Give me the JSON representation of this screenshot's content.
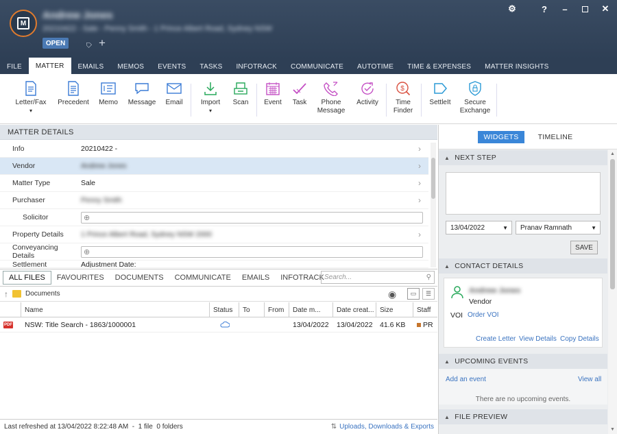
{
  "header": {
    "client_name": "Andrew Jones",
    "matter_line": "20210422 - Sale - Penny Smith - 1 Prince Albert Road, Sydney NSW",
    "status_badge": "OPEN",
    "window_controls": [
      "gear-icon",
      "help-icon",
      "minimize-icon",
      "maximize-icon",
      "close-icon"
    ],
    "help_label": "?"
  },
  "tabs": [
    "FILE",
    "MATTER",
    "EMAILS",
    "MEMOS",
    "EVENTS",
    "TASKS",
    "INFOTRACK",
    "COMMUNICATE",
    "AUTOTIME",
    "TIME & EXPENSES",
    "MATTER INSIGHTS"
  ],
  "active_tab": "MATTER",
  "ribbon": {
    "items": [
      {
        "line1": "Letter/Fax",
        "line2": "▾",
        "icon": "letter-icon",
        "color": "#3a7bd5"
      },
      {
        "line1": "Precedent",
        "line2": "",
        "icon": "precedent-icon",
        "color": "#3a7bd5"
      },
      {
        "line1": "Memo",
        "line2": "",
        "icon": "memo-icon",
        "color": "#3a7bd5"
      },
      {
        "line1": "Message",
        "line2": "",
        "icon": "message-icon",
        "color": "#3a7bd5"
      },
      {
        "line1": "Email",
        "line2": "",
        "icon": "email-icon",
        "color": "#3a7bd5"
      },
      {
        "line1": "Import",
        "line2": "▾",
        "icon": "import-icon",
        "color": "#27a85a"
      },
      {
        "line1": "Scan",
        "line2": "",
        "icon": "scan-icon",
        "color": "#27a85a"
      },
      {
        "line1": "Event",
        "line2": "",
        "icon": "event-icon",
        "color": "#c44fc4"
      },
      {
        "line1": "Task",
        "line2": "",
        "icon": "task-icon",
        "color": "#c44fc4"
      },
      {
        "line1": "Phone",
        "line2": "Message",
        "icon": "phone-icon",
        "color": "#c44fc4"
      },
      {
        "line1": "Activity",
        "line2": "",
        "icon": "activity-icon",
        "color": "#c44fc4"
      },
      {
        "line1": "Time",
        "line2": "Finder",
        "icon": "time-finder-icon",
        "color": "#d9503f"
      },
      {
        "line1": "SettleIt",
        "line2": "",
        "icon": "settleit-icon",
        "color": "#2a9ad6"
      },
      {
        "line1": "Secure",
        "line2": "Exchange",
        "icon": "secure-exchange-icon",
        "color": "#2a9ad6"
      }
    ]
  },
  "matter_details": {
    "header": "MATTER DETAILS",
    "rows": [
      {
        "label": "Info",
        "value": "20210422 -"
      },
      {
        "label": "Vendor",
        "value": "Andrew Jones"
      },
      {
        "label": "Matter Type",
        "value": "Sale"
      },
      {
        "label": "Purchaser",
        "value": "Penny Smith"
      },
      {
        "label": "Solicitor",
        "value": ""
      },
      {
        "label": "Property Details",
        "value": "1 Prince Albert Road, Sydney NSW 2000"
      },
      {
        "label": "Conveyancing Details",
        "value": ""
      },
      {
        "label": "Settlement Financials",
        "value": "Adjustment Date:"
      }
    ]
  },
  "files": {
    "tabs": [
      "ALL FILES",
      "FAVOURITES",
      "DOCUMENTS",
      "COMMUNICATE",
      "EMAILS",
      "INFOTRACK"
    ],
    "search_placeholder": "Search...",
    "folder": "Documents",
    "columns": [
      "Name",
      "Status",
      "To",
      "From",
      "Date m...",
      "Date creat...",
      "Size",
      "Staff"
    ],
    "rows": [
      {
        "type": "PDF",
        "name": "NSW: Title Search - 1863/1000001",
        "status": "cloud-icon",
        "to": "",
        "from": "",
        "date_modified": "13/04/2022",
        "date_created": "13/04/2022",
        "size": "41.6 KB",
        "staff": "PR"
      }
    ]
  },
  "statusbar": {
    "text": "Last refreshed at 13/04/2022 8:22:48 AM  -  1 file  0 folders",
    "link": "Uploads, Downloads & Exports"
  },
  "right_panel": {
    "view_tabs": [
      "WIDGETS",
      "TIMELINE"
    ],
    "next_step": {
      "header": "NEXT STEP",
      "date": "13/04/2022",
      "staff": "Pranav Ramnath",
      "save": "SAVE"
    },
    "contact": {
      "header": "CONTACT DETAILS",
      "name": "Andrew Jones",
      "role": "Vendor",
      "voi_label": "VOI",
      "voi_link": "Order VOI",
      "links": [
        "Create Letter",
        "View Details",
        "Copy Details"
      ]
    },
    "upcoming": {
      "header": "UPCOMING EVENTS",
      "add": "Add an event",
      "view_all": "View all",
      "empty": "There are no upcoming events."
    },
    "preview": {
      "header": "FILE PREVIEW"
    }
  },
  "colors": {
    "accent": "#3a7bd5",
    "titlebar": "#2e3f55",
    "logo_ring": "#e07b2e",
    "pdf_red": "#d6312b",
    "staff_marker": "#c6752c"
  }
}
